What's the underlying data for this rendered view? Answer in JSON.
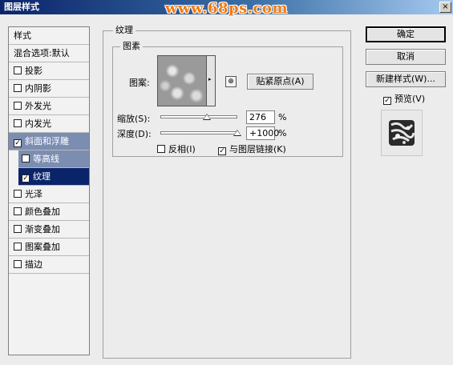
{
  "window": {
    "title": "图层样式",
    "watermark": "www.68ps.com",
    "close_label": "×"
  },
  "sidebar": {
    "header": "样式",
    "blend_options": "混合选项:默认",
    "items": [
      {
        "label": "投影",
        "checked": false
      },
      {
        "label": "内阴影",
        "checked": false
      },
      {
        "label": "外发光",
        "checked": false
      },
      {
        "label": "内发光",
        "checked": false
      },
      {
        "label": "斜面和浮雕",
        "checked": true
      },
      {
        "label": "等高线",
        "checked": false
      },
      {
        "label": "纹理",
        "checked": true
      },
      {
        "label": "光泽",
        "checked": false
      },
      {
        "label": "颜色叠加",
        "checked": false
      },
      {
        "label": "渐变叠加",
        "checked": false
      },
      {
        "label": "图案叠加",
        "checked": false
      },
      {
        "label": "描边",
        "checked": false
      }
    ]
  },
  "texture": {
    "group_title": "纹理",
    "elements_title": "图素",
    "pattern_label": "图案:",
    "snap_button": "贴紧原点(A)",
    "scale_label": "缩放(S):",
    "scale_value": "276",
    "scale_slider_fraction": 0.276,
    "percent": "%",
    "depth_label": "深度(D):",
    "depth_value": "+1000",
    "depth_slider_fraction": 1.0,
    "invert_label": "反相(I)",
    "invert_checked": false,
    "link_label": "与图层链接(K)",
    "link_checked": true
  },
  "actions": {
    "ok": "确定",
    "cancel": "取消",
    "new_style": "新建样式(W)...",
    "preview_label": "预览(V)",
    "preview_checked": true
  },
  "check_glyph": "✓",
  "dropdown_glyph": "▸",
  "snap_glyph": "⊕"
}
